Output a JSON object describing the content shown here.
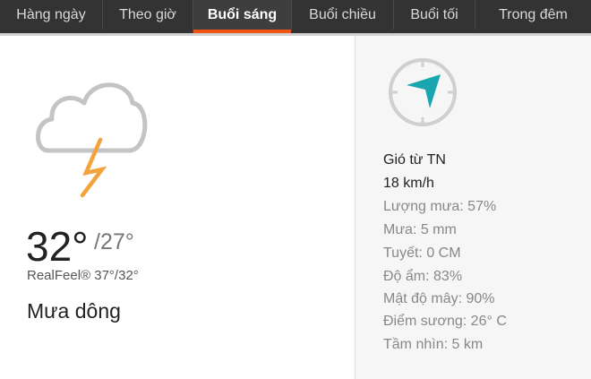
{
  "tabs": [
    {
      "label": "Hàng ngày",
      "active": false
    },
    {
      "label": "Theo giờ",
      "active": false
    },
    {
      "label": "Buổi sáng",
      "active": true
    },
    {
      "label": "Buổi chiều",
      "active": false
    },
    {
      "label": "Buổi tối",
      "active": false
    },
    {
      "label": "Trong đêm",
      "active": false
    }
  ],
  "colors": {
    "accent": "#f05514",
    "tab_bar": "#333333",
    "compass_arrow": "#1aa6b0",
    "bolt": "#f3a23c"
  },
  "forecast": {
    "icon": "cloud-lightning-icon",
    "temp_high": "32°",
    "temp_low": "/27°",
    "realfeel": "RealFeel® 37°/32°",
    "phrase": "Mưa dông"
  },
  "wind": {
    "icon": "compass-icon",
    "direction": "Gió từ TN",
    "speed": "18 km/h"
  },
  "details": [
    "Lượng mưa: 57%",
    "Mưa: 5 mm",
    "Tuyết: 0 CM",
    "Độ ẩm: 83%",
    "Mật độ mây: 90%",
    "Điểm sương: 26° C",
    "Tầm nhìn: 5 km"
  ]
}
